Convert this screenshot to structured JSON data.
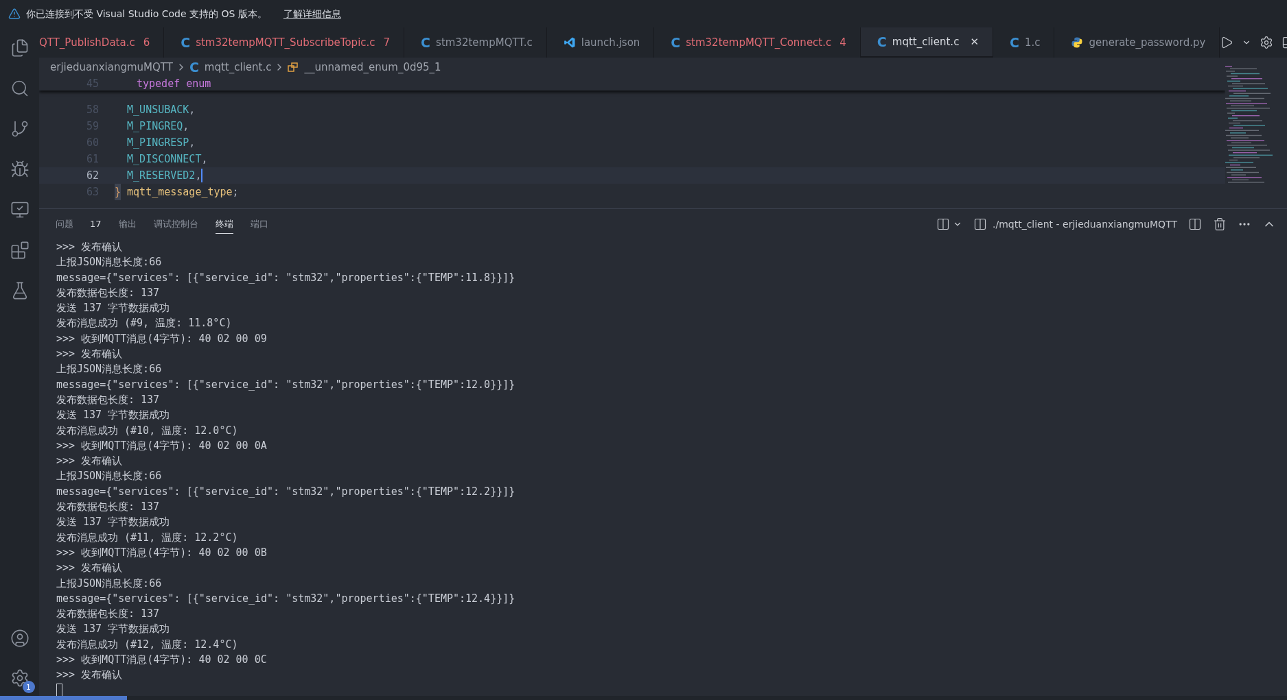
{
  "notification": {
    "message": "你已连接到不受 Visual Studio Code 支持的 OS 版本。",
    "link": "了解详细信息"
  },
  "activity_bar": {
    "items": [
      {
        "kind": "files"
      },
      {
        "kind": "search"
      },
      {
        "kind": "source-control"
      },
      {
        "kind": "debug"
      },
      {
        "kind": "remote"
      },
      {
        "kind": "extensions"
      },
      {
        "kind": "testing"
      }
    ],
    "bottom": [
      {
        "kind": "account"
      },
      {
        "kind": "settings",
        "badge": "1"
      }
    ]
  },
  "tabs": [
    {
      "label": "QTT_PublishData.c",
      "kind": "plain",
      "problems": "6",
      "error": true,
      "selected": false
    },
    {
      "label": "stm32tempMQTT_SubscribeTopic.c",
      "kind": "c",
      "letter": "C",
      "problems": "7",
      "error": true,
      "selected": false
    },
    {
      "label": "stm32tempMQTT.c",
      "kind": "c",
      "letter": "C",
      "error": false,
      "selected": false
    },
    {
      "label": "launch.json",
      "kind": "vscode",
      "error": false,
      "selected": false
    },
    {
      "label": "stm32tempMQTT_Connect.c",
      "kind": "c",
      "letter": "C",
      "problems": "4",
      "error": true,
      "selected": false
    },
    {
      "label": "mqtt_client.c",
      "kind": "c",
      "letter": "C",
      "close": "✕",
      "error": false,
      "selected": true
    },
    {
      "label": "1.c",
      "kind": "c",
      "letter": "C",
      "error": false,
      "selected": false
    },
    {
      "label": "generate_password.py",
      "kind": "python",
      "error": false,
      "selected": false
    }
  ],
  "breadcrumb": [
    {
      "label": "erjieduanxiangmuMQTT",
      "kind": "plain"
    },
    {
      "label": "mqtt_client.c",
      "kind": "c",
      "letter": "C"
    },
    {
      "label": "__unnamed_enum_0d95_1",
      "kind": "enum"
    }
  ],
  "editor": {
    "sticky": {
      "number": "45",
      "tokens": [
        {
          "text": "typedef enum",
          "kind": "keyword"
        }
      ]
    },
    "lines": [
      {
        "number": "58",
        "current": false,
        "indent": true,
        "tokens": [
          {
            "text": "M_UNSUBACK",
            "kind": "constant"
          },
          {
            "text": ",",
            "kind": "punct"
          }
        ]
      },
      {
        "number": "59",
        "current": false,
        "indent": true,
        "tokens": [
          {
            "text": "M_PINGREQ",
            "kind": "constant"
          },
          {
            "text": ",",
            "kind": "punct"
          }
        ]
      },
      {
        "number": "60",
        "current": false,
        "indent": true,
        "tokens": [
          {
            "text": "M_PINGRESP",
            "kind": "constant"
          },
          {
            "text": ",",
            "kind": "punct"
          }
        ]
      },
      {
        "number": "61",
        "current": false,
        "indent": true,
        "tokens": [
          {
            "text": "M_DISCONNECT",
            "kind": "constant"
          },
          {
            "text": ",",
            "kind": "punct"
          }
        ]
      },
      {
        "number": "62",
        "current": true,
        "indent": true,
        "tokens": [
          {
            "text": "M_RESERVED2",
            "kind": "constant"
          },
          {
            "text": ",",
            "kind": "punct"
          }
        ]
      },
      {
        "number": "63",
        "current": false,
        "indent": false,
        "tokens": [
          {
            "text": "}",
            "kind": "brace"
          },
          {
            "text": "mqtt_message_type",
            "kind": "type"
          },
          {
            "text": ";",
            "kind": "punct"
          }
        ]
      }
    ]
  },
  "panel": {
    "tabs": [
      {
        "label": "问题",
        "count": "17",
        "selected": false
      },
      {
        "label": "输出",
        "selected": false
      },
      {
        "label": "调试控制台",
        "selected": false
      },
      {
        "label": "终端",
        "selected": true
      },
      {
        "label": "端口",
        "selected": false
      }
    ],
    "terminal_name": "./mqtt_client - erjieduanxiangmuMQTT",
    "terminal_lines": [
      ">>> 发布确认",
      "上报JSON消息长度:66",
      "message={\"services\": [{\"service_id\": \"stm32\",\"properties\":{\"TEMP\":11.8}}]}",
      "发布数据包长度: 137",
      "发送 137 字节数据成功",
      "发布消息成功 (#9, 温度: 11.8°C)",
      ">>> 收到MQTT消息(4字节): 40 02 00 09",
      ">>> 发布确认",
      "上报JSON消息长度:66",
      "message={\"services\": [{\"service_id\": \"stm32\",\"properties\":{\"TEMP\":12.0}}]}",
      "发布数据包长度: 137",
      "发送 137 字节数据成功",
      "发布消息成功 (#10, 温度: 12.0°C)",
      ">>> 收到MQTT消息(4字节): 40 02 00 0A",
      ">>> 发布确认",
      "上报JSON消息长度:66",
      "message={\"services\": [{\"service_id\": \"stm32\",\"properties\":{\"TEMP\":12.2}}]}",
      "发布数据包长度: 137",
      "发送 137 字节数据成功",
      "发布消息成功 (#11, 温度: 12.2°C)",
      ">>> 收到MQTT消息(4字节): 40 02 00 0B",
      ">>> 发布确认",
      "上报JSON消息长度:66",
      "message={\"services\": [{\"service_id\": \"stm32\",\"properties\":{\"TEMP\":12.4}}]}",
      "发布数据包长度: 137",
      "发送 137 字节数据成功",
      "发布消息成功 (#12, 温度: 12.4°C)",
      ">>> 收到MQTT消息(4字节): 40 02 00 0C",
      ">>> 发布确认"
    ]
  }
}
